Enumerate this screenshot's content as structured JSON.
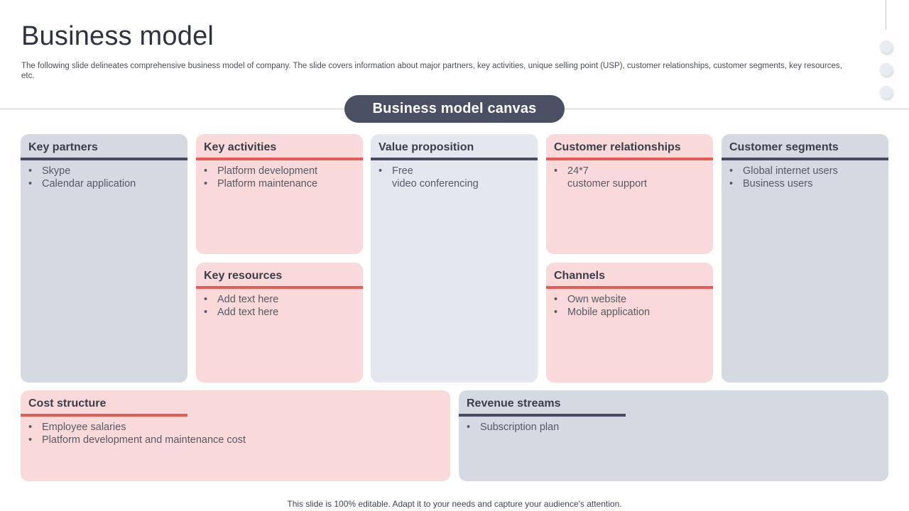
{
  "slide": {
    "title": "Business model",
    "subtitle": "The following slide delineates comprehensive business model of company. The slide covers information about major partners, key activities, unique selling point (USP), customer relationships, customer segments, key resources, etc.",
    "canvas_label": "Business model canvas",
    "footer": "This slide is 100% editable. Adapt it to your needs and capture your audience's attention."
  },
  "blocks": {
    "key_partners": {
      "title": "Key partners",
      "items": [
        "Skype",
        "Calendar application"
      ]
    },
    "key_activities": {
      "title": "Key activities",
      "items": [
        "Platform development",
        "Platform maintenance"
      ]
    },
    "key_resources": {
      "title": "Key resources",
      "items": [
        "Add text here",
        "Add text here"
      ]
    },
    "value_proposition": {
      "title": "Value proposition",
      "items": [
        {
          "line1": "Free",
          "line2": "video conferencing"
        }
      ]
    },
    "customer_relationships": {
      "title": "Customer relationships",
      "items": [
        {
          "line1": "24*7",
          "line2": "customer support"
        }
      ]
    },
    "channels": {
      "title": "Channels",
      "items": [
        "Own website",
        "Mobile application"
      ]
    },
    "customer_segments": {
      "title": "Customer segments",
      "items": [
        "Global internet users",
        "Business users"
      ]
    },
    "cost_structure": {
      "title": "Cost structure",
      "items": [
        "Employee salaries",
        "Platform development and maintenance cost"
      ]
    },
    "revenue_streams": {
      "title": "Revenue streams",
      "items": [
        "Subscription plan"
      ]
    }
  },
  "bullet_glyph": "•",
  "colors": {
    "gray_card": "#d5d9e1",
    "light_card": "#e4e7ed",
    "pink_card": "#f9d9d9",
    "dark_accent": "#464c61",
    "red_accent": "#e85a54"
  }
}
